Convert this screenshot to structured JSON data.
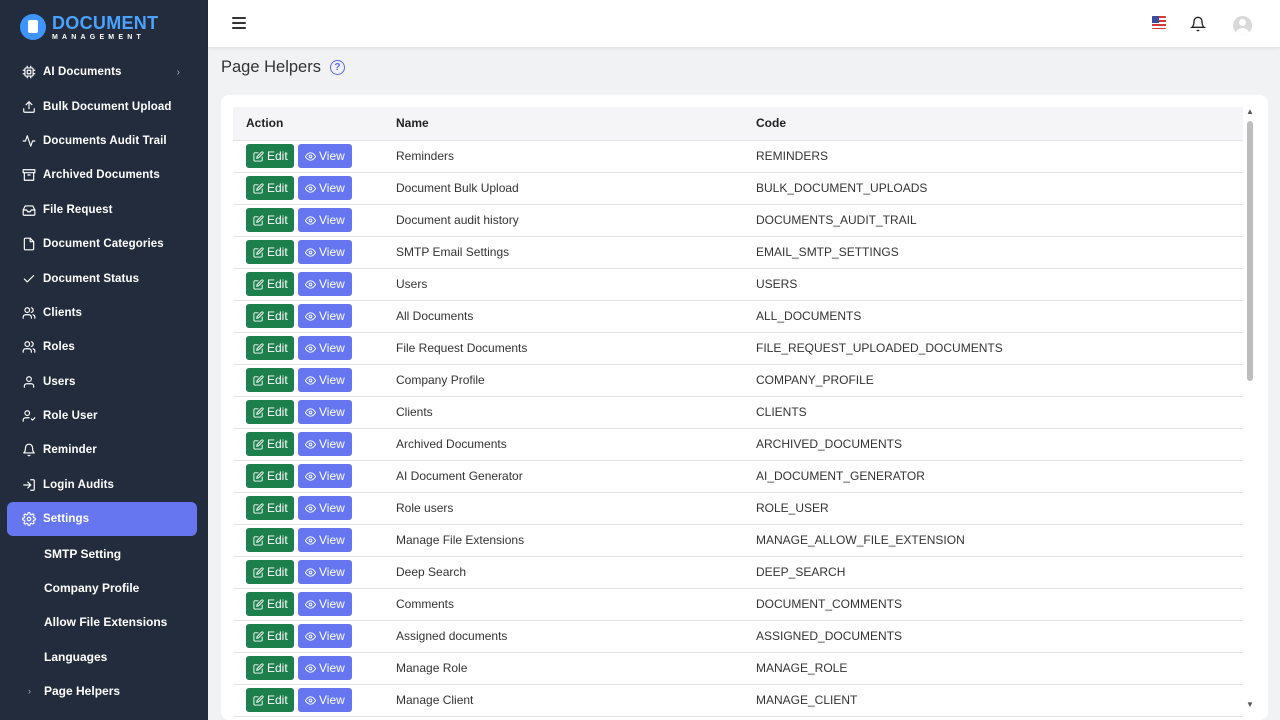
{
  "brand": {
    "title": "DOCUMENT",
    "subtitle": "MANAGEMENT"
  },
  "sidebar": {
    "items": [
      {
        "label": "AI Documents",
        "icon": "cpu-icon",
        "has_children": true
      },
      {
        "label": "Bulk Document Upload",
        "icon": "upload-icon"
      },
      {
        "label": "Documents Audit Trail",
        "icon": "activity-icon"
      },
      {
        "label": "Archived Documents",
        "icon": "archive-icon"
      },
      {
        "label": "File Request",
        "icon": "inbox-icon"
      },
      {
        "label": "Document Categories",
        "icon": "file-icon"
      },
      {
        "label": "Document Status",
        "icon": "check-icon"
      },
      {
        "label": "Clients",
        "icon": "users-icon"
      },
      {
        "label": "Roles",
        "icon": "users-icon"
      },
      {
        "label": "Users",
        "icon": "user-icon"
      },
      {
        "label": "Role User",
        "icon": "user-check-icon"
      },
      {
        "label": "Reminder",
        "icon": "bell-icon"
      },
      {
        "label": "Login Audits",
        "icon": "login-icon"
      }
    ],
    "active": {
      "label": "Settings",
      "icon": "gear-icon"
    },
    "submenu": [
      {
        "label": "SMTP Setting"
      },
      {
        "label": "Company Profile"
      },
      {
        "label": "Allow File Extensions"
      },
      {
        "label": "Languages"
      },
      {
        "label": "Page Helpers",
        "current": true
      }
    ]
  },
  "header": {
    "menu_icon": "hamburger-icon",
    "flag_icon": "us-flag-icon",
    "notification_icon": "bell-icon",
    "avatar_icon": "avatar-icon"
  },
  "page": {
    "title": "Page Helpers",
    "help_glyph": "?"
  },
  "table": {
    "columns": [
      "Action",
      "Name",
      "Code"
    ],
    "edit_label": "Edit",
    "view_label": "View",
    "rows": [
      {
        "name": "Reminders",
        "code": "REMINDERS"
      },
      {
        "name": "Document Bulk Upload",
        "code": "BULK_DOCUMENT_UPLOADS"
      },
      {
        "name": "Document audit history",
        "code": "DOCUMENTS_AUDIT_TRAIL"
      },
      {
        "name": "SMTP Email Settings",
        "code": "EMAIL_SMTP_SETTINGS"
      },
      {
        "name": "Users",
        "code": "USERS"
      },
      {
        "name": "All Documents",
        "code": "ALL_DOCUMENTS"
      },
      {
        "name": "File Request Documents",
        "code": "FILE_REQUEST_UPLOADED_DOCUMENTS"
      },
      {
        "name": "Company Profile",
        "code": "COMPANY_PROFILE"
      },
      {
        "name": "Clients",
        "code": "CLIENTS"
      },
      {
        "name": "Archived Documents",
        "code": "ARCHIVED_DOCUMENTS"
      },
      {
        "name": "AI Document Generator",
        "code": "AI_DOCUMENT_GENERATOR"
      },
      {
        "name": "Role users",
        "code": "ROLE_USER"
      },
      {
        "name": "Manage File Extensions",
        "code": "MANAGE_ALLOW_FILE_EXTENSION"
      },
      {
        "name": "Deep Search",
        "code": "DEEP_SEARCH"
      },
      {
        "name": "Comments",
        "code": "DOCUMENT_COMMENTS"
      },
      {
        "name": "Assigned documents",
        "code": "ASSIGNED_DOCUMENTS"
      },
      {
        "name": "Manage Role",
        "code": "MANAGE_ROLE"
      },
      {
        "name": "Manage Client",
        "code": "MANAGE_CLIENT"
      }
    ]
  },
  "colors": {
    "sidebar_bg": "#232c3d",
    "accent": "#6676f1",
    "edit_green": "#1c7f4c",
    "brand_blue": "#4aa3ff"
  }
}
